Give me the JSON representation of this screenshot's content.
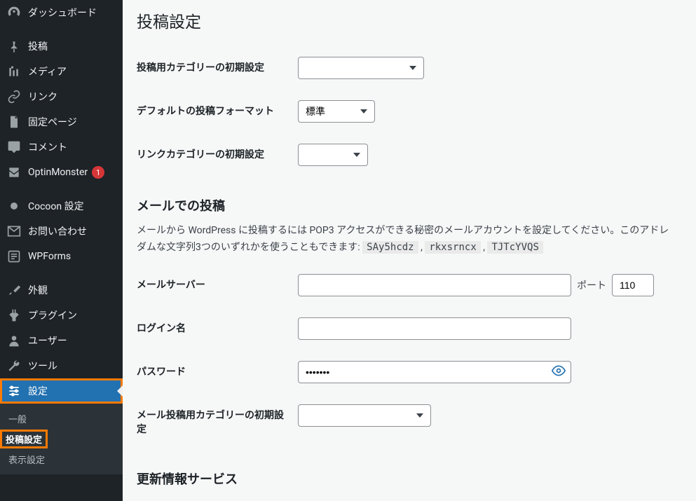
{
  "sidebar": {
    "items": [
      {
        "icon": "dashboard",
        "label": "ダッシュボード",
        "name": "sidebar-item-dashboard"
      },
      {
        "sep": true
      },
      {
        "icon": "pin",
        "label": "投稿",
        "name": "sidebar-item-posts"
      },
      {
        "icon": "media",
        "label": "メディア",
        "name": "sidebar-item-media"
      },
      {
        "icon": "link",
        "label": "リンク",
        "name": "sidebar-item-links"
      },
      {
        "icon": "page",
        "label": "固定ページ",
        "name": "sidebar-item-pages"
      },
      {
        "icon": "comment",
        "label": "コメント",
        "name": "sidebar-item-comments"
      },
      {
        "icon": "optin",
        "label": "OptinMonster",
        "name": "sidebar-item-optinmonster",
        "badge": "1"
      },
      {
        "sep": true
      },
      {
        "icon": "dot",
        "label": "Cocoon 設定",
        "name": "sidebar-item-cocoon"
      },
      {
        "icon": "envelope",
        "label": "お問い合わせ",
        "name": "sidebar-item-contact"
      },
      {
        "icon": "wpforms",
        "label": "WPForms",
        "name": "sidebar-item-wpforms"
      },
      {
        "sep": true
      },
      {
        "icon": "brush",
        "label": "外観",
        "name": "sidebar-item-appearance"
      },
      {
        "icon": "plugin",
        "label": "プラグイン",
        "name": "sidebar-item-plugins"
      },
      {
        "icon": "user",
        "label": "ユーザー",
        "name": "sidebar-item-users"
      },
      {
        "icon": "wrench",
        "label": "ツール",
        "name": "sidebar-item-tools"
      },
      {
        "icon": "sliders",
        "label": "設定",
        "name": "sidebar-item-settings",
        "active": true,
        "highlight": true
      }
    ],
    "submenu": [
      {
        "label": "一般",
        "name": "submenu-general"
      },
      {
        "label": "投稿設定",
        "name": "submenu-writing",
        "current": true,
        "highlight": true
      },
      {
        "label": "表示設定",
        "name": "submenu-reading"
      }
    ]
  },
  "page": {
    "title": "投稿設定",
    "rows": {
      "default_category": {
        "label": "投稿用カテゴリーの初期設定",
        "value": ""
      },
      "default_format": {
        "label": "デフォルトの投稿フォーマット",
        "value": "標準"
      },
      "link_category": {
        "label": "リンクカテゴリーの初期設定",
        "value": ""
      }
    },
    "mail_section": {
      "heading": "メールでの投稿",
      "desc_prefix": "メールから WordPress に投稿するには POP3 アクセスができる秘密のメールアカウントを設定してください。このアドレ",
      "desc_line2_prefix": "ダムな文字列3つのいずれかを使うこともできます: ",
      "codes": [
        "SAy5hcdz",
        "rkxsrncx",
        "TJTcYVQS"
      ],
      "comma": " , ",
      "mail_server_label": "メールサーバー",
      "port_label": "ポート",
      "port_value": "110",
      "login_label": "ログイン名",
      "login_value": "",
      "password_label": "パスワード",
      "password_value": "•••••••",
      "mail_category_label": "メール投稿用カテゴリーの初期設定",
      "mail_category_value": ""
    },
    "update_heading": "更新情報サービス"
  }
}
